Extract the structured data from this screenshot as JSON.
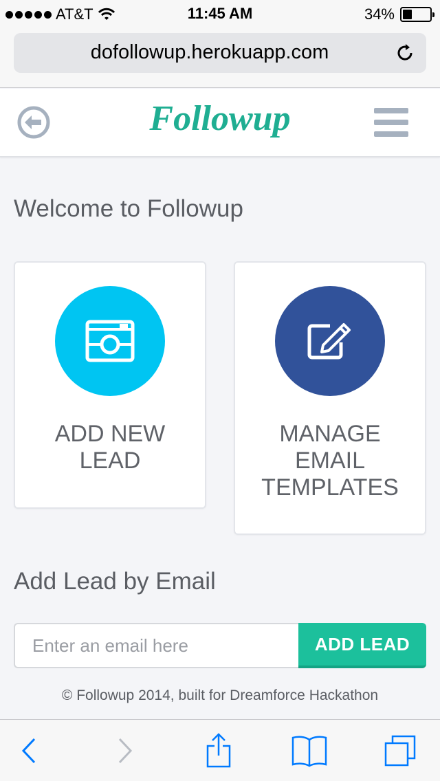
{
  "status_bar": {
    "carrier": "AT&T",
    "time": "11:45 AM",
    "battery_percent_label": "34%",
    "battery_level": 0.34
  },
  "browser": {
    "url": "dofollowup.herokuapp.com"
  },
  "header": {
    "brand": "Followup",
    "icons": {
      "back": "circle-arrow-left-icon",
      "menu": "hamburger-menu-icon"
    }
  },
  "main": {
    "welcome": "Welcome to Followup",
    "cards": [
      {
        "label": "ADD NEW LEAD",
        "icon": "camera-icon",
        "color": "#00c5f2"
      },
      {
        "label": "MANAGE EMAIL TEMPLATES",
        "icon": "edit-pencil-icon",
        "color": "#31529a"
      }
    ],
    "add_by_email": {
      "heading": "Add Lead by Email",
      "placeholder": "Enter an email here",
      "value": "",
      "button": "ADD LEAD"
    },
    "footer": "© Followup 2014, built for Dreamforce Hackathon"
  },
  "colors": {
    "brand": "#1fae92",
    "button": "#1cc09c",
    "ios_blue": "#007aff"
  }
}
